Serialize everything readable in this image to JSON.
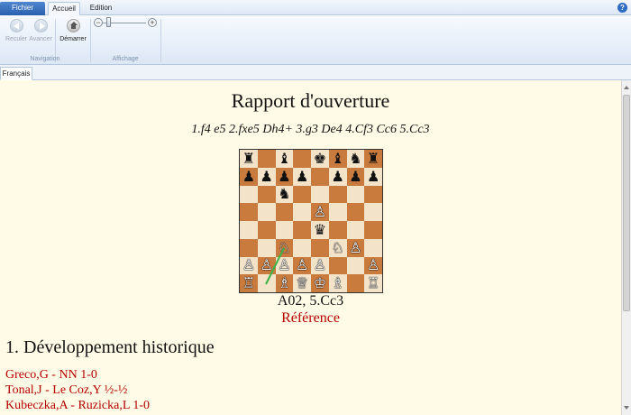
{
  "ribbon": {
    "tabs": [
      "Fichier",
      "Accueil",
      "Edition"
    ],
    "active_tab": "Accueil",
    "navigation": {
      "back_label": "Reculer",
      "forward_label": "Avancer",
      "start_label": "Démarrer",
      "group_label": "Navigation"
    },
    "affichage": {
      "group_label": "Affichage",
      "zoom_minus": "−",
      "zoom_plus": "+"
    },
    "help_label": "?"
  },
  "document_tab": "Français",
  "report": {
    "title": "Rapport d'ouverture",
    "moves": "1.f4 e5 2.fxe5 Dh4+ 3.g3 De4 4.Cf3 Cc6 5.Cc3",
    "eco": "A02, 5.Cc3",
    "reference_label": "Référence",
    "section_heading": "1. Développement historique",
    "games": [
      "Greco,G - NN 1-0",
      "Tonal,J - Le Coz,Y ½-½",
      "Kubeczka,A - Ruzicka,L 1-0"
    ]
  },
  "board": {
    "ranks": [
      [
        "♜",
        "",
        "♝",
        "",
        "♚",
        "♝",
        "♞",
        "♜"
      ],
      [
        "♟",
        "♟",
        "♟",
        "♟",
        "",
        "♟",
        "♟",
        "♟"
      ],
      [
        "",
        "",
        "♞",
        "",
        "",
        "",
        "",
        ""
      ],
      [
        "",
        "",
        "",
        "",
        "♙",
        "",
        "",
        ""
      ],
      [
        "",
        "",
        "",
        "",
        "♛",
        "",
        "",
        ""
      ],
      [
        "",
        "",
        "♘",
        "",
        "",
        "♘",
        "♙",
        ""
      ],
      [
        "♙",
        "♙",
        "♙",
        "♙",
        "♙",
        "",
        "",
        "♙"
      ],
      [
        "♖",
        "",
        "♗",
        "♕",
        "♔",
        "♗",
        "",
        "♖"
      ]
    ],
    "last_move": [
      "b1",
      "c3"
    ],
    "light_square_color": "#f3e3c9",
    "dark_square_color": "#c97a3d",
    "arrow_color": "#3fb24a"
  }
}
